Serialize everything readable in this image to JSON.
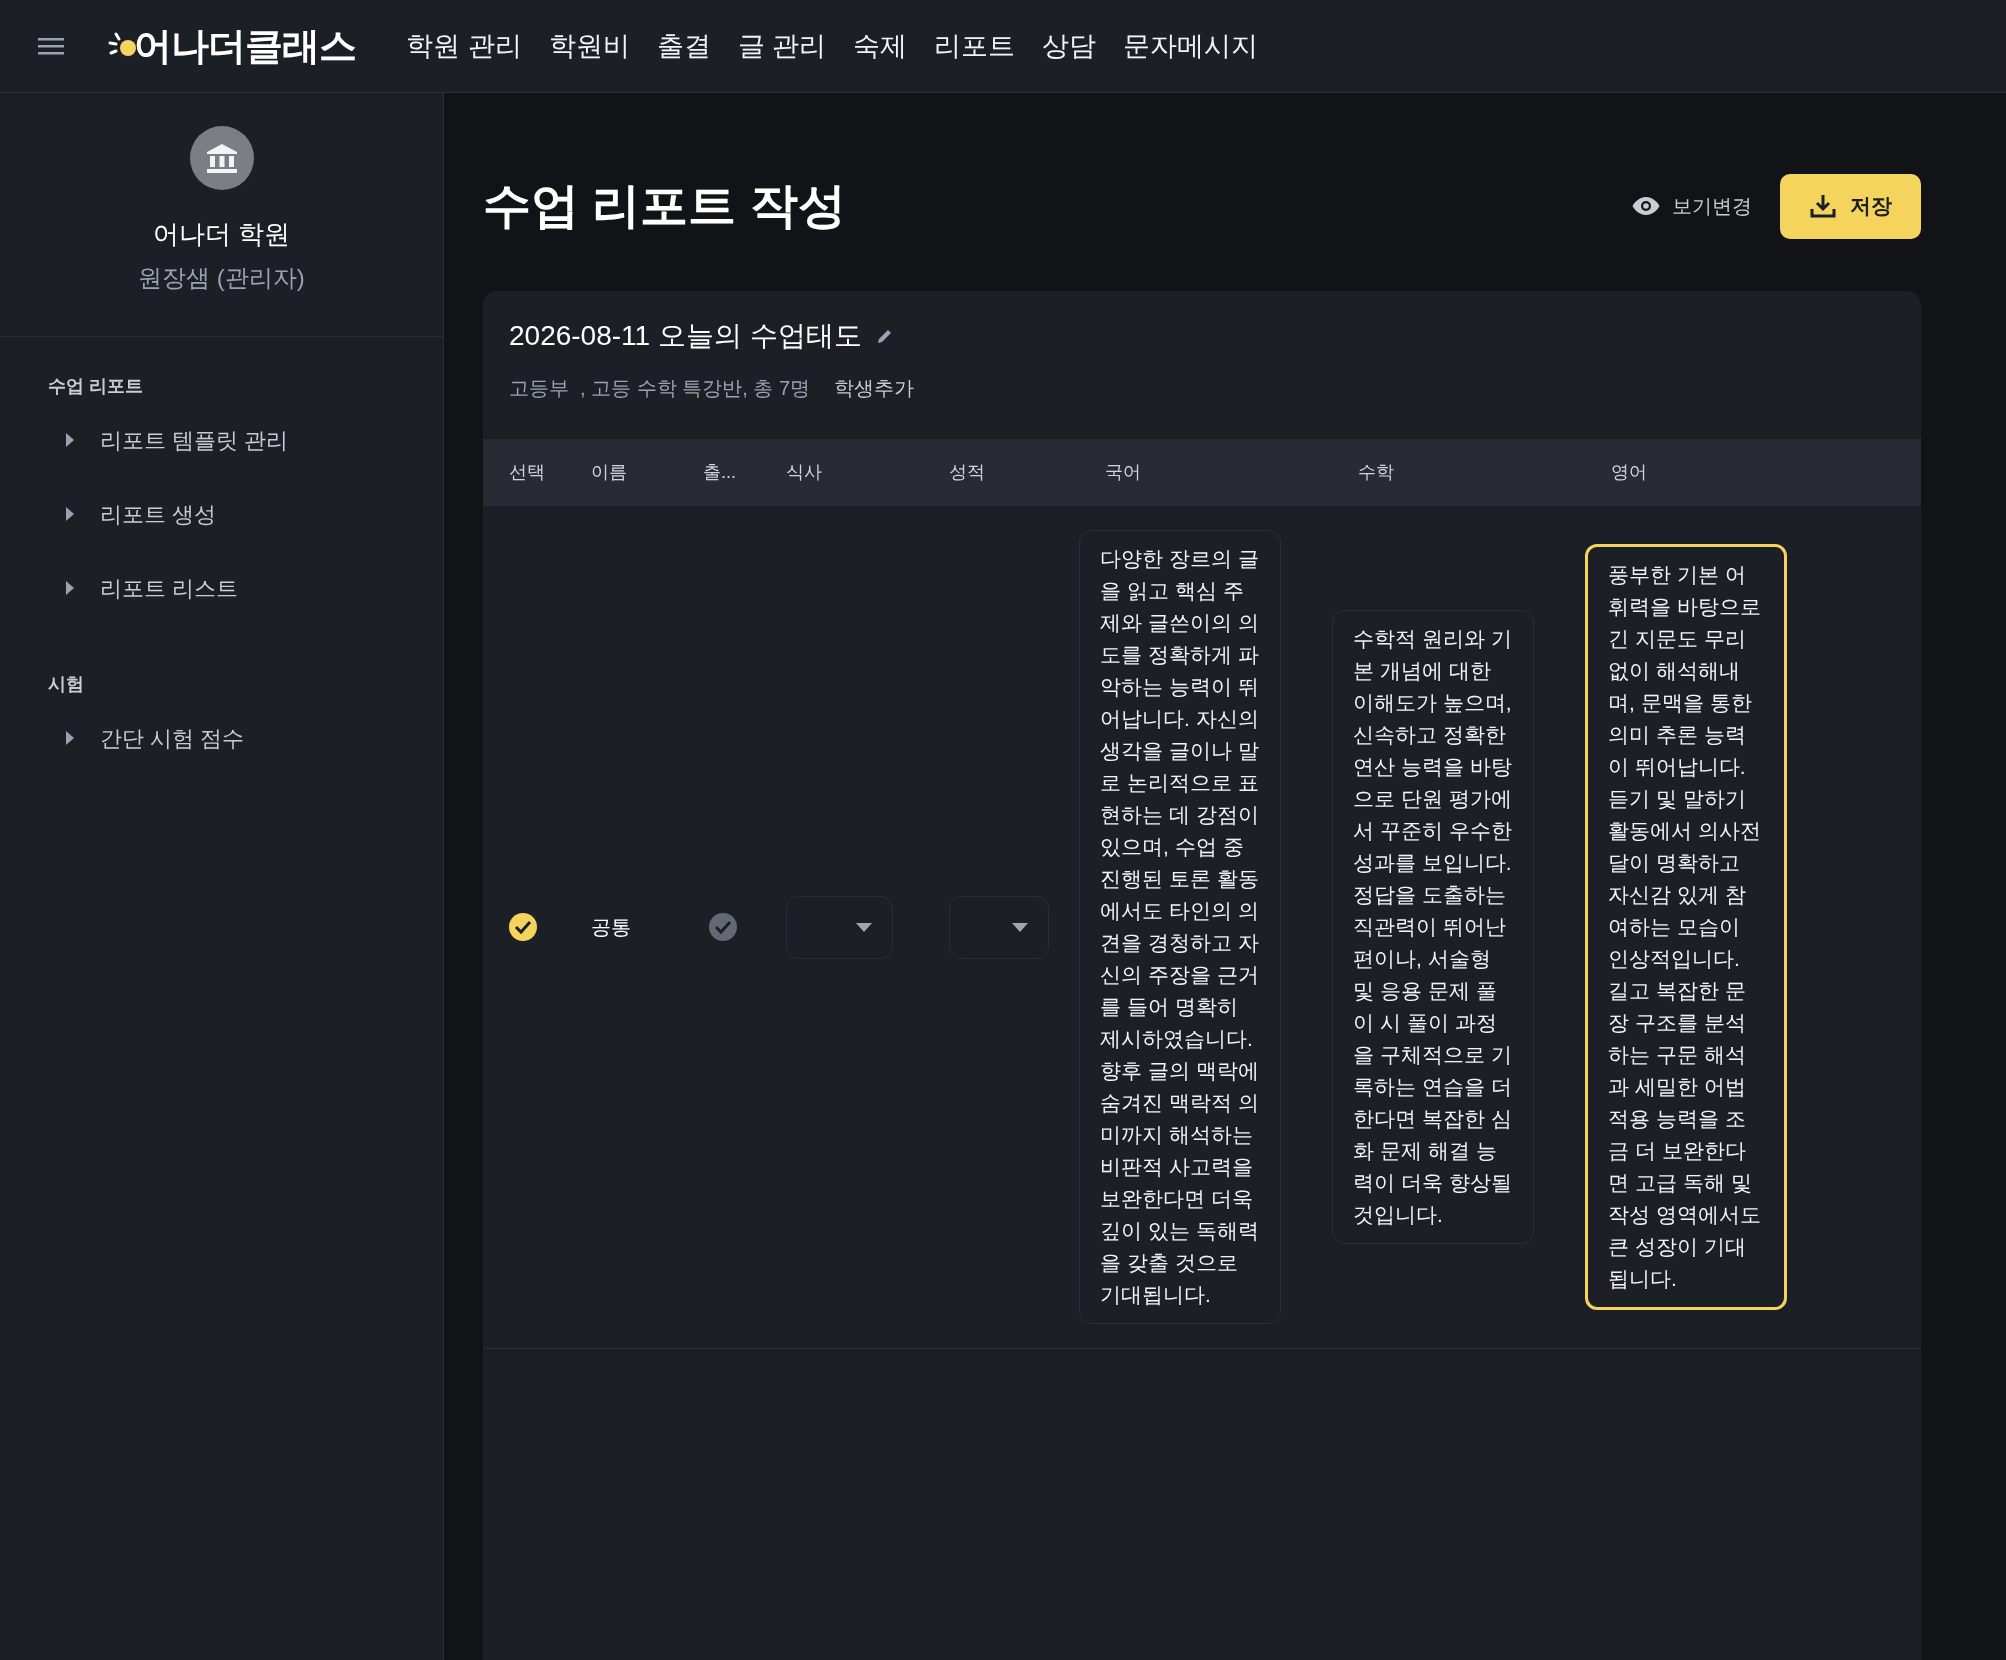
{
  "header": {
    "logo": "어나더클래스",
    "nav": [
      {
        "label": "학원 관리"
      },
      {
        "label": "학원비"
      },
      {
        "label": "출결"
      },
      {
        "label": "글 관리"
      },
      {
        "label": "숙제"
      },
      {
        "label": "리포트"
      },
      {
        "label": "상담"
      },
      {
        "label": "문자메시지"
      }
    ]
  },
  "sidebar": {
    "academy": "어나더 학원",
    "role": "원장샘 (관리자)",
    "sections": [
      {
        "title": "수업 리포트",
        "items": [
          {
            "label": "리포트 템플릿 관리"
          },
          {
            "label": "리포트 생성"
          },
          {
            "label": "리포트 리스트"
          }
        ]
      },
      {
        "title": "시험",
        "items": [
          {
            "label": "간단 시험 점수"
          }
        ]
      }
    ]
  },
  "page": {
    "title": "수업 리포트 작성",
    "view_toggle": "보기변경",
    "save_button": "저장"
  },
  "card": {
    "title": "2026-08-11 오늘의 수업태도",
    "subtitle": "고등부  , 고등 수학 특강반, 총 7명",
    "add_student": "학생추가",
    "table": {
      "columns": [
        "선택",
        "이름",
        "출...",
        "식사",
        "성적",
        "국어",
        "수학",
        "영어"
      ],
      "rows": [
        {
          "selected": true,
          "name": "공통",
          "attendance_checked": false,
          "comments": [
            {
              "text": "다양한 장르의 글을 읽고 핵심 주제와 글쓴이의 의도를 정확하게 파악하는 능력이 뛰어납니다. 자신의 생각을 글이나 말로 논리적으로 표현하는 데 강점이 있으며, 수업 중 진행된 토론 활동에서도 타인의 의견을 경청하고 자신의 주장을 근거를 들어 명확히 제시하였습니다. 향후 글의 맥락에 숨겨진 맥락적 의미까지 해석하는 비판적 사고력을 보완한다면 더욱 깊이 있는 독해력을 갖출 것으로 기대됩니다.",
              "selected": false
            },
            {
              "text": "수학적 원리와 기본 개념에 대한 이해도가 높으며, 신속하고 정확한 연산 능력을 바탕으로 단원 평가에서 꾸준히 우수한 성과를 보입니다. 정답을 도출하는 직관력이 뛰어난 편이나, 서술형 및 응용 문제 풀이 시 풀이 과정을 구체적으로 기록하는 연습을 더한다면 복잡한 심화 문제 해결 능력이 더욱 향상될 것입니다.",
              "selected": false
            },
            {
              "text": "풍부한 기본 어휘력을 바탕으로 긴 지문도 무리 없이 해석해내며, 문맥을 통한 의미 추론 능력이 뛰어납니다. 듣기 및 말하기 활동에서 의사전달이 명확하고 자신감 있게 참여하는 모습이 인상적입니다. 길고 복잡한 문장 구조를 분석하는 구문 해석과 세밀한 어법 적용 능력을 조금 더 보완한다면 고급 독해 및 작성 영역에서도 큰 성장이 기대됩니다.",
              "selected": true
            }
          ]
        }
      ]
    }
  }
}
